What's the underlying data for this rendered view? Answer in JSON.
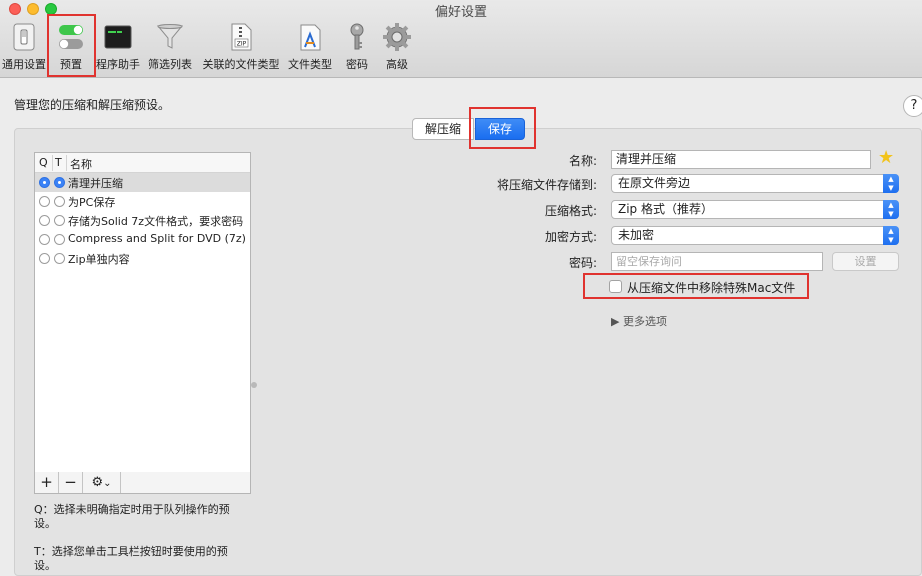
{
  "window": {
    "title": "偏好设置"
  },
  "toolbar": {
    "items": [
      {
        "label": "通用设置",
        "icon": "switch-icon"
      },
      {
        "label": "预置",
        "icon": "toggles-icon"
      },
      {
        "label": "程序助手",
        "icon": "terminal-icon"
      },
      {
        "label": "筛选列表",
        "icon": "funnel-icon"
      },
      {
        "label": "关联的文件类型",
        "icon": "zip-file-icon"
      },
      {
        "label": "文件类型",
        "icon": "app-document-icon"
      },
      {
        "label": "密码",
        "icon": "key-icon"
      },
      {
        "label": "高级",
        "icon": "gear-icon"
      }
    ]
  },
  "description": "管理您的压缩和解压缩预设。",
  "help": "?",
  "segments": {
    "decompress": "解压缩",
    "save": "保存"
  },
  "list": {
    "headers": {
      "q": "Q",
      "t": "T",
      "name": "名称"
    },
    "rows": [
      {
        "name": "清理并压缩",
        "q": true,
        "t": true
      },
      {
        "name": "为PC保存",
        "q": false,
        "t": false
      },
      {
        "name": "存储为Solid 7z文件格式，要求密码",
        "q": false,
        "t": false
      },
      {
        "name": "Compress and Split for DVD (7z)",
        "q": false,
        "t": false
      },
      {
        "name": "Zip单独内容",
        "q": false,
        "t": false
      }
    ],
    "bar": {
      "add": "+",
      "remove": "−",
      "gear": "⚙",
      "chevron": "⌄"
    }
  },
  "notes": {
    "q": "Q：选择未明确指定时用于队列操作的预设。",
    "t": "T：选择您单击工具栏按钮时要使用的预设。"
  },
  "form": {
    "name_label": "名称:",
    "name_value": "清理并压缩",
    "store_label": "将压缩文件存储到:",
    "store_value": "在原文件旁边",
    "format_label": "压缩格式:",
    "format_value": "Zip 格式（推荐）",
    "encrypt_label": "加密方式:",
    "encrypt_value": "未加密",
    "password_label": "密码:",
    "password_placeholder": "留空保存询问",
    "set_button": "设置",
    "remove_mac_label": "从压缩文件中移除特殊Mac文件",
    "more_options": "▶ 更多选项"
  },
  "colors": {
    "accent": "#1a6ef0",
    "highlight": "#e0332f"
  }
}
